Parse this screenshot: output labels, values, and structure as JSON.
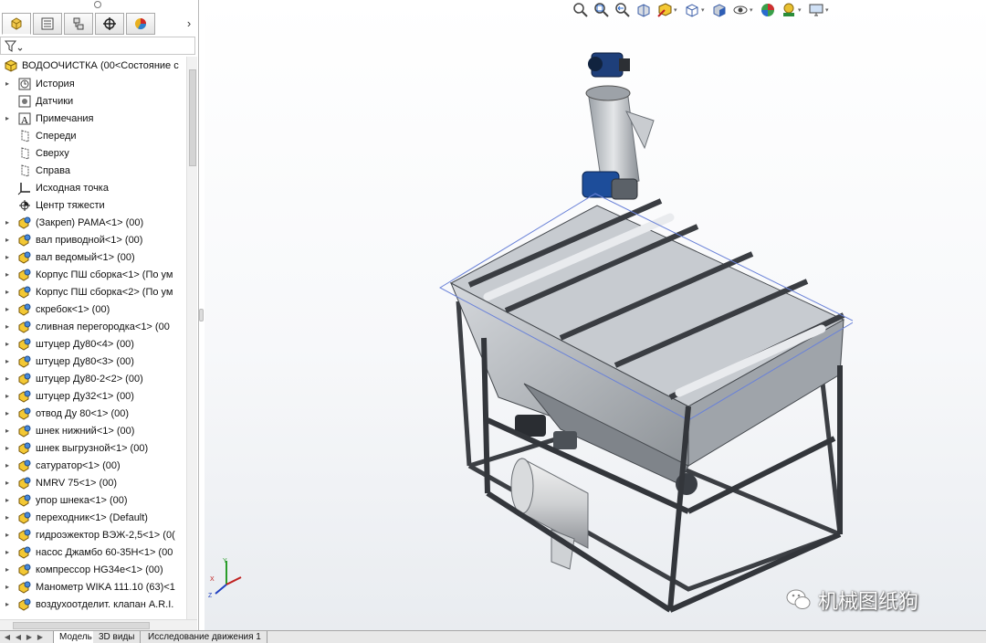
{
  "feature_tree": {
    "root": {
      "label": "ВОДООЧИСТКА  (00<Состояние с"
    },
    "items": [
      {
        "label": "История",
        "icon": "history-icon",
        "expandable": true
      },
      {
        "label": "Датчики",
        "icon": "sensors-icon",
        "expandable": false
      },
      {
        "label": "Примечания",
        "icon": "annotations-icon",
        "expandable": true
      },
      {
        "label": "Спереди",
        "icon": "plane-icon",
        "expandable": false
      },
      {
        "label": "Сверху",
        "icon": "plane-icon",
        "expandable": false
      },
      {
        "label": "Справа",
        "icon": "plane-icon",
        "expandable": false
      },
      {
        "label": "Исходная точка",
        "icon": "origin-icon",
        "expandable": false
      },
      {
        "label": "Центр тяжести",
        "icon": "center-of-mass-icon",
        "expandable": false
      },
      {
        "label": "(Закреп) РАМА<1> (00)",
        "icon": "assembly-icon",
        "expandable": true
      },
      {
        "label": "вал приводной<1> (00)",
        "icon": "assembly-icon",
        "expandable": true
      },
      {
        "label": "вал ведомый<1> (00)",
        "icon": "assembly-icon",
        "expandable": true
      },
      {
        "label": "Корпус ПШ сборка<1> (По ум",
        "icon": "assembly-icon",
        "expandable": true
      },
      {
        "label": "Корпус ПШ сборка<2> (По ум",
        "icon": "assembly-icon",
        "expandable": true
      },
      {
        "label": "скребок<1> (00)",
        "icon": "assembly-icon",
        "expandable": true
      },
      {
        "label": "сливная перегородка<1> (00",
        "icon": "assembly-icon",
        "expandable": true
      },
      {
        "label": "штуцер Ду80<4> (00)",
        "icon": "assembly-icon",
        "expandable": true
      },
      {
        "label": "штуцер Ду80<3> (00)",
        "icon": "assembly-icon",
        "expandable": true
      },
      {
        "label": "штуцер Ду80-2<2> (00)",
        "icon": "assembly-icon",
        "expandable": true
      },
      {
        "label": "штуцер Ду32<1> (00)",
        "icon": "assembly-icon",
        "expandable": true
      },
      {
        "label": "отвод Ду 80<1> (00)",
        "icon": "assembly-icon",
        "expandable": true
      },
      {
        "label": "шнек нижний<1> (00)",
        "icon": "assembly-icon",
        "expandable": true
      },
      {
        "label": "шнек выгрузной<1> (00)",
        "icon": "assembly-icon",
        "expandable": true
      },
      {
        "label": "сатуратор<1> (00)",
        "icon": "assembly-icon",
        "expandable": true
      },
      {
        "label": "NMRV 75<1> (00)",
        "icon": "assembly-icon",
        "expandable": true
      },
      {
        "label": "упор шнека<1> (00)",
        "icon": "assembly-icon",
        "expandable": true
      },
      {
        "label": "переходник<1> (Default)",
        "icon": "assembly-icon",
        "expandable": true
      },
      {
        "label": "гидроэжектор ВЭЖ-2,5<1> (0(",
        "icon": "assembly-icon",
        "expandable": true
      },
      {
        "label": "насос Джамбо 60-35Н<1> (00",
        "icon": "assembly-icon",
        "expandable": true
      },
      {
        "label": "компрессор HG34e<1> (00)",
        "icon": "assembly-icon",
        "expandable": true
      },
      {
        "label": "Манометр WIKA 111.10 (63)<1",
        "icon": "assembly-icon",
        "expandable": true
      },
      {
        "label": "воздухоотделит. клапан A.R.I.",
        "icon": "assembly-icon",
        "expandable": true
      }
    ]
  },
  "bottom_tabs": [
    {
      "label": "Модель",
      "active": true
    },
    {
      "label": "3D виды",
      "active": false
    },
    {
      "label": "Исследование движения 1",
      "active": false
    }
  ],
  "hud_tools": [
    "zoom-to-fit-icon",
    "zoom-to-area-icon",
    "previous-view-icon",
    "section-view-icon",
    "dynamic-annotation-icon",
    "view-orientation-icon",
    "display-style-icon",
    "hide-show-items-icon",
    "edit-appearance-icon",
    "apply-scene-icon",
    "view-settings-icon"
  ],
  "triad": {
    "x": "X",
    "y": "Y",
    "z": "Z"
  },
  "watermark": {
    "text": "机械图纸狗"
  },
  "colors": {
    "accent": "#1e5ca8",
    "frame": "#3c3f44",
    "tank": "#a8acb2"
  }
}
